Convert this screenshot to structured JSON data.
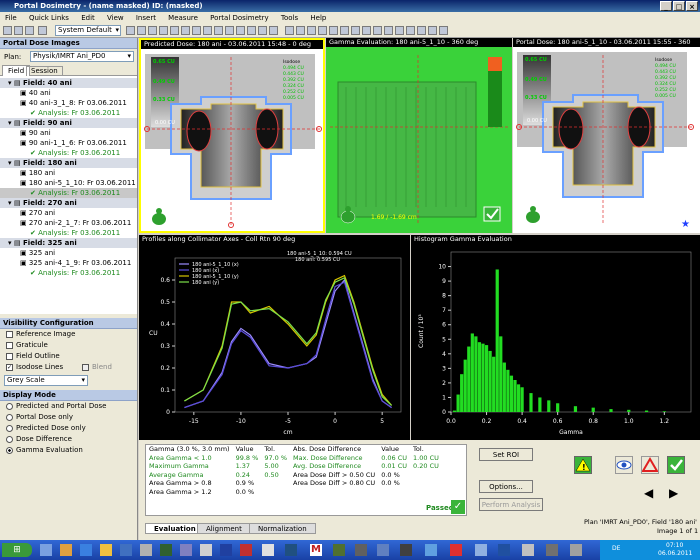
{
  "window": {
    "title": "Portal Dosimetry - (name masked) ID: (masked)"
  },
  "menu": [
    "File",
    "Quick Links",
    "Edit",
    "View",
    "Insert",
    "Measure",
    "Portal Dosimetry",
    "Tools",
    "Help"
  ],
  "toolbar": {
    "profile": "System Default"
  },
  "left": {
    "header": "Portal Dose Images",
    "plan_label": "Plan:",
    "plan_value": "Physik/IMRT Ani_PD0",
    "tabs": [
      "Field",
      "Session"
    ],
    "fields": [
      {
        "name": "Field: 40 ani",
        "sub": "40 ani",
        "image": "40 ani-3_1_8: Fr 03.06.2011",
        "analysis": "Analysis: Fr 03.06.2011"
      },
      {
        "name": "Field: 90 ani",
        "sub": "90 ani",
        "image": "90 ani-1_1_6: Fr 03.06.2011",
        "analysis": "Analysis: Fr 03.06.2011"
      },
      {
        "name": "Field: 180 ani",
        "sub": "180 ani",
        "image": "180 ani-5_1_10: Fr 03.06.2011",
        "analysis": "Analysis: Fr 03.06.2011"
      },
      {
        "name": "Field: 270 ani",
        "sub": "270 ani",
        "image": "270 ani-2_1_7: Fr 03.06.2011",
        "analysis": "Analysis: Fr 03.06.2011"
      },
      {
        "name": "Field: 325 ani",
        "sub": "325 ani",
        "image": "325 ani-4_1_9: Fr 03.06.2011",
        "analysis": "Analysis: Fr 03.06.2011"
      }
    ],
    "visibility_header": "Visibility Configuration",
    "visibility": [
      {
        "label": "Reference Image",
        "checked": false
      },
      {
        "label": "Graticule",
        "checked": false
      },
      {
        "label": "Field Outline",
        "checked": false
      },
      {
        "label": "Isodose Lines",
        "checked": true
      }
    ],
    "blend": "Blend",
    "grey_scale": "Grey Scale",
    "display_header": "Display Mode",
    "display_modes": [
      {
        "label": "Predicted and Portal Dose",
        "selected": false
      },
      {
        "label": "Portal Dose only",
        "selected": false
      },
      {
        "label": "Predicted Dose only",
        "selected": false
      },
      {
        "label": "Dose Difference",
        "selected": false
      },
      {
        "label": "Gamma Evaluation",
        "selected": true
      }
    ]
  },
  "panels": {
    "predicted": "Predicted Dose: 180 ani - 03.06.2011 15:48 - 0 deg",
    "gamma": "Gamma Evaluation: 180 ani-5_1_10 - 360 deg",
    "portal": "Portal Dose: 180 ani-5_1_10 - 03.06.2011 15:55 - 360 deg",
    "profiles": "Profiles along Collimator Axes - Coll Rtn 90 deg",
    "histogram": "Histogram Gamma Evaluation",
    "gamma_coords": "1.69 / -1.69 cm",
    "profile_readout_1": "180 ani-5_1_10: 0.594 CU",
    "profile_readout_2": "180 ani: 0.595 CU",
    "isodose_title": "Isodose",
    "isodose_levels": [
      "0.494 CU",
      "0.443 CU",
      "0.392 CU",
      "0.324 CU",
      "0.252 CU",
      "0.005 CU"
    ],
    "scale_top": "0.65 CU",
    "scale_mid1": "0.49 CU",
    "scale_mid2": "0.33 CU",
    "scale_bot": "0.00 CU"
  },
  "chart_data": [
    {
      "type": "line",
      "title": "Profiles along Collimator Axes - Coll Rtn 90 deg",
      "xlabel": "cm",
      "ylabel": "CU",
      "xlim": [
        -17,
        7
      ],
      "ylim": [
        0,
        0.7
      ],
      "x_ticks": [
        "-15",
        "-10",
        "-5",
        "0",
        "5"
      ],
      "y_ticks": [
        "0",
        "0.1",
        "0.2",
        "0.3",
        "0.4",
        "0.5",
        "0.6"
      ],
      "series": [
        {
          "name": "180 ani-5_1_10 (x)",
          "color": "#9b8cff",
          "x": [
            -16,
            -14,
            -12,
            -11,
            -10,
            -9,
            -7,
            -5,
            -3,
            -2,
            -1,
            0,
            1,
            2,
            3,
            4,
            5,
            6
          ],
          "y": [
            0.02,
            0.05,
            0.18,
            0.32,
            0.38,
            0.35,
            0.22,
            0.2,
            0.22,
            0.25,
            0.4,
            0.55,
            0.6,
            0.45,
            0.3,
            0.15,
            0.05,
            0.02
          ]
        },
        {
          "name": "180 ani (x)",
          "color": "#5a4cd8",
          "x": [
            -16,
            -14,
            -12,
            -11,
            -10,
            -9,
            -7,
            -5,
            -3,
            -2,
            -1,
            0,
            1,
            2,
            3,
            4,
            5,
            6
          ],
          "y": [
            0.02,
            0.05,
            0.17,
            0.31,
            0.37,
            0.34,
            0.21,
            0.2,
            0.22,
            0.26,
            0.42,
            0.57,
            0.59,
            0.44,
            0.29,
            0.14,
            0.05,
            0.02
          ]
        },
        {
          "name": "180 ani-5_1_10 (y)",
          "color": "#d6c600",
          "x": [
            -16,
            -14,
            -12,
            -11,
            -10,
            -9,
            -7,
            -5,
            -3,
            -2,
            -1,
            0,
            1,
            2,
            3,
            4,
            5,
            6
          ],
          "y": [
            0.05,
            0.1,
            0.3,
            0.5,
            0.5,
            0.45,
            0.48,
            0.4,
            0.3,
            0.35,
            0.5,
            0.6,
            0.62,
            0.5,
            0.35,
            0.2,
            0.08,
            0.03
          ]
        },
        {
          "name": "180 ani (y)",
          "color": "#7be04b",
          "x": [
            -16,
            -14,
            -12,
            -11,
            -10,
            -9,
            -7,
            -5,
            -3,
            -2,
            -1,
            0,
            1,
            2,
            3,
            4,
            5,
            6
          ],
          "y": [
            0.05,
            0.1,
            0.29,
            0.49,
            0.5,
            0.46,
            0.47,
            0.41,
            0.31,
            0.36,
            0.51,
            0.59,
            0.61,
            0.49,
            0.34,
            0.19,
            0.07,
            0.03
          ]
        }
      ]
    },
    {
      "type": "bar",
      "title": "Histogram Gamma Evaluation",
      "xlabel": "Gamma",
      "ylabel": "Count / 10³",
      "xlim": [
        0,
        1.35
      ],
      "ylim": [
        0,
        11
      ],
      "x_ticks": [
        "0.0",
        "0.2",
        "0.4",
        "0.6",
        "0.8",
        "1.0",
        "1.2"
      ],
      "y_ticks": [
        "0",
        "1",
        "2",
        "3",
        "4",
        "5",
        "6",
        "7",
        "8",
        "9",
        "10"
      ],
      "x": [
        0.02,
        0.04,
        0.06,
        0.08,
        0.1,
        0.12,
        0.14,
        0.16,
        0.18,
        0.2,
        0.22,
        0.24,
        0.26,
        0.28,
        0.3,
        0.32,
        0.34,
        0.36,
        0.38,
        0.4,
        0.45,
        0.5,
        0.55,
        0.6,
        0.7,
        0.8,
        0.9,
        1.0,
        1.1,
        1.2
      ],
      "values": [
        0.1,
        1.2,
        2.6,
        3.6,
        4.5,
        5.4,
        5.2,
        4.8,
        4.7,
        4.6,
        4.2,
        3.8,
        9.8,
        5.2,
        3.4,
        2.9,
        2.5,
        2.2,
        1.9,
        1.7,
        1.3,
        1.0,
        0.8,
        0.6,
        0.4,
        0.3,
        0.2,
        0.15,
        0.1,
        0.05
      ]
    }
  ],
  "results": {
    "header": [
      "Gamma (3.0 %, 3.0 mm)",
      "Value",
      "Tol.",
      "Abs. Dose Difference",
      "Value",
      "Tol."
    ],
    "rows": [
      [
        "Area Gamma < 1.0",
        "99.8 %",
        "97.0 %",
        "Max. Dose Difference",
        "0.06 CU",
        "1.00 CU"
      ],
      [
        "Maximum Gamma",
        "1.37",
        "5.00",
        "Avg. Dose Difference",
        "0.01 CU",
        "0.20 CU"
      ],
      [
        "Average Gamma",
        "0.24",
        "0.50",
        "Area Dose Diff > 0.50 CU",
        "0.0 %",
        ""
      ],
      [
        "Area Gamma > 0.8",
        "0.9 %",
        "",
        "Area Dose Diff > 0.80 CU",
        "0.0 %",
        ""
      ],
      [
        "Area Gamma > 1.2",
        "0.0 %",
        "",
        "",
        "",
        ""
      ]
    ],
    "passed": "Passed",
    "set_roi": "Set ROI",
    "options": "Options...",
    "perform": "Perform Analysis",
    "tabs": [
      "Evaluation",
      "Alignment",
      "Normalization"
    ],
    "plan_info": "Plan 'IMRT Ani_PD0', Field '180 ani'",
    "image_info": "Image 1 of 1"
  },
  "taskbar": {
    "lang": "DE",
    "time": "07:10",
    "date": "06.06.2011"
  }
}
